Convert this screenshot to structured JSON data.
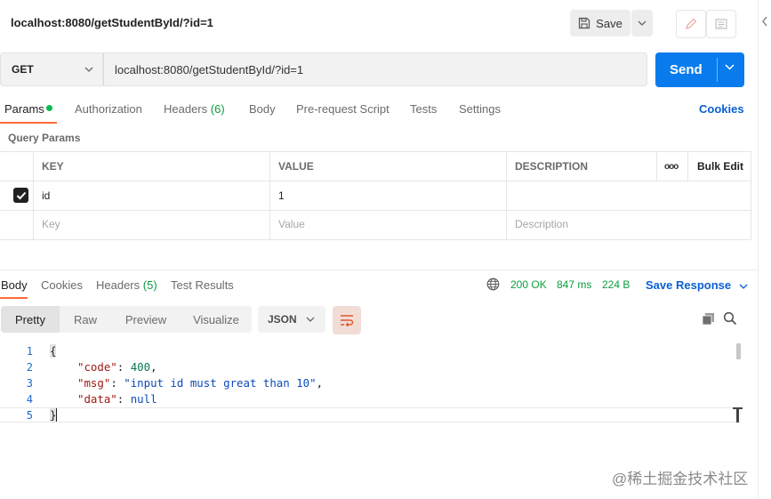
{
  "window": {
    "title": "localhost:8080/getStudentById/?id=1"
  },
  "toolbar": {
    "save_label": "Save"
  },
  "request": {
    "method": "GET",
    "url": "localhost:8080/getStudentById/?id=1",
    "send_label": "Send"
  },
  "request_tabs": {
    "params": "Params",
    "authorization": "Authorization",
    "headers": "Headers",
    "headers_count": "(6)",
    "body": "Body",
    "pre_request_script": "Pre-request Script",
    "tests": "Tests",
    "settings": "Settings",
    "cookies": "Cookies"
  },
  "query_params": {
    "title": "Query Params",
    "headers": {
      "key": "KEY",
      "value": "VALUE",
      "description": "DESCRIPTION",
      "more": "ooo",
      "bulk_edit": "Bulk Edit"
    },
    "rows": [
      {
        "checked": true,
        "key": "id",
        "value": "1",
        "description": ""
      }
    ],
    "placeholder": {
      "key": "Key",
      "value": "Value",
      "description": "Description"
    }
  },
  "response_tabs": {
    "body": "Body",
    "cookies": "Cookies",
    "headers": "Headers",
    "headers_count": "(5)",
    "test_results": "Test Results"
  },
  "response_status": {
    "status": "200 OK",
    "time": "847 ms",
    "size": "224 B",
    "save_response": "Save Response"
  },
  "view_modes": {
    "pretty": "Pretty",
    "raw": "Raw",
    "preview": "Preview",
    "visualize": "Visualize",
    "format": "JSON"
  },
  "response_body": {
    "line_numbers": [
      "1",
      "2",
      "3",
      "4",
      "5"
    ],
    "open_brace": "{",
    "close_brace": "}",
    "code_key": "\"code\"",
    "code_value": "400",
    "msg_key": "\"msg\"",
    "msg_value": "\"input id must great than 10\"",
    "data_key": "\"data\"",
    "data_value": "null",
    "colon": ": ",
    "comma": ","
  },
  "watermark": "@稀土掘金技术社区",
  "colors": {
    "send": "#097bed",
    "accent": "#ff6c37",
    "link": "#0b5fd6",
    "success": "#0a9e3d"
  }
}
